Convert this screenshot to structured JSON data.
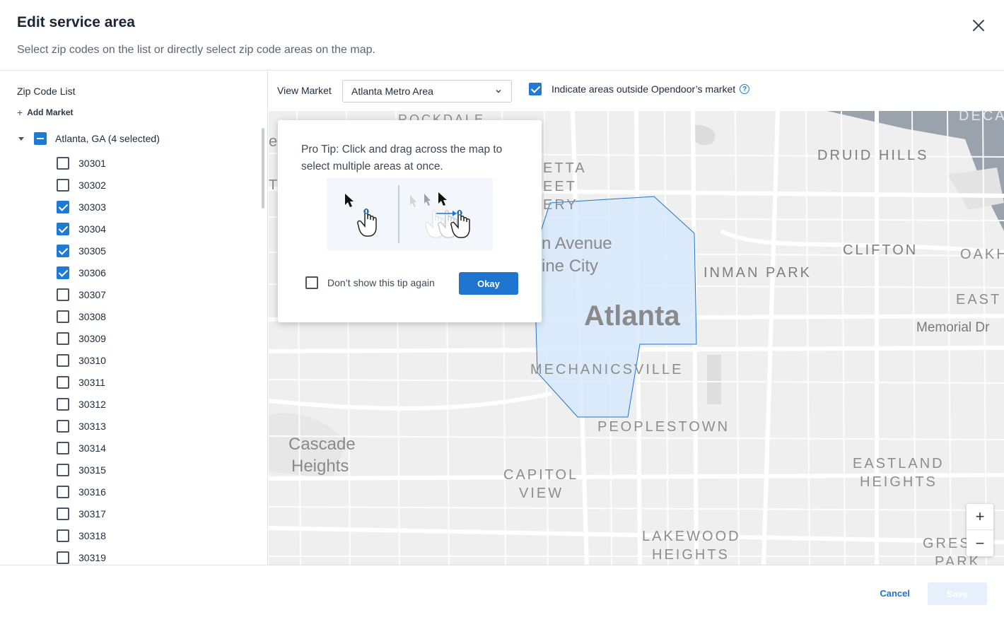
{
  "header": {
    "title": "Edit service area",
    "subtitle": "Select zip codes on the list or directly select zip code areas on the map."
  },
  "sidebar": {
    "heading": "Zip Code List",
    "add_market": "Add Market",
    "group": {
      "label": "Atlanta, GA (4 selected)",
      "state": "indeterminate"
    },
    "zips": [
      {
        "code": "30301",
        "checked": false
      },
      {
        "code": "30302",
        "checked": false
      },
      {
        "code": "30303",
        "checked": true
      },
      {
        "code": "30304",
        "checked": true
      },
      {
        "code": "30305",
        "checked": true
      },
      {
        "code": "30306",
        "checked": true
      },
      {
        "code": "30307",
        "checked": false
      },
      {
        "code": "30308",
        "checked": false
      },
      {
        "code": "30309",
        "checked": false
      },
      {
        "code": "30310",
        "checked": false
      },
      {
        "code": "30311",
        "checked": false
      },
      {
        "code": "30312",
        "checked": false
      },
      {
        "code": "30313",
        "checked": false
      },
      {
        "code": "30314",
        "checked": false
      },
      {
        "code": "30315",
        "checked": false
      },
      {
        "code": "30316",
        "checked": false
      },
      {
        "code": "30317",
        "checked": false
      },
      {
        "code": "30318",
        "checked": false
      },
      {
        "code": "30319",
        "checked": false
      }
    ]
  },
  "toolbar": {
    "view_market_label": "View Market",
    "market_selected": "Atlanta Metro Area",
    "indicate_label": "Indicate areas outside Opendoor’s market",
    "indicate_checked": true,
    "help_glyph": "?"
  },
  "map": {
    "labels": [
      "ROCKDALE",
      "ETTA",
      "EET",
      "ERY",
      "DRUID HILLS",
      "DECA",
      "CLIFTON",
      "OAKH",
      "n Avenue",
      "ine City",
      "INMAN PARK",
      "EAST",
      "Atlanta",
      "Memorial Dr",
      "MECHANICSVILLE",
      "PEOPLESTOWN",
      "Cascade",
      "Heights",
      "CAPITOL",
      "VIEW",
      "EASTLAND",
      "HEIGHTS",
      "LAKEWOOD",
      "HEIGHTS",
      "GRES",
      "PARK",
      "e",
      "T"
    ],
    "zoom_in": "+",
    "zoom_out": "−"
  },
  "tip": {
    "text": "Pro Tip: Click and drag across the map to select multiple areas at once.",
    "dont_show": "Don’t show this tip again",
    "okay": "Okay"
  },
  "footer": {
    "cancel": "Cancel",
    "save": "Save"
  },
  "colors": {
    "accent": "#1f74cf",
    "selection_fill": "#dcecfb",
    "selection_stroke": "#1f74cf",
    "outside_market": "#8e97a3"
  }
}
